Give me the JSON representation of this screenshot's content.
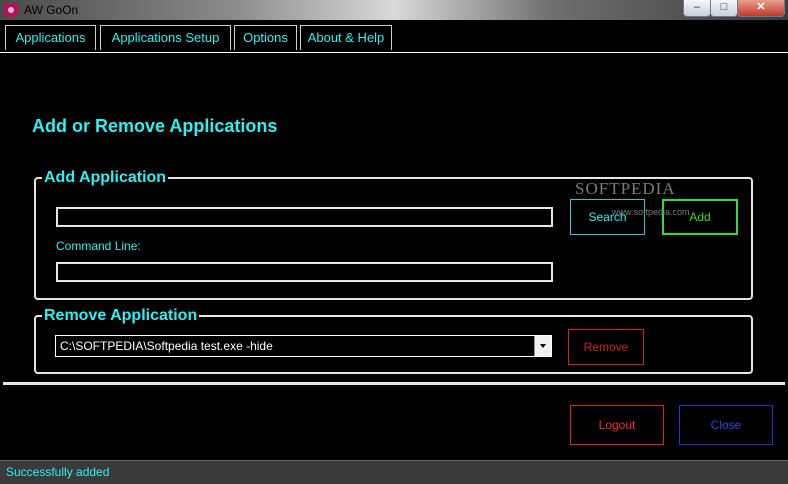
{
  "window": {
    "title": "AW GoOn",
    "controls": {
      "minimize": "–",
      "maximize": "□",
      "close": "✕"
    }
  },
  "tabs": [
    {
      "label": "Applications"
    },
    {
      "label": "Applications Setup"
    },
    {
      "label": "Options"
    },
    {
      "label": "About & Help"
    }
  ],
  "main": {
    "heading": "Add or Remove Applications",
    "add_group": {
      "title": "Add Application",
      "path_value": "",
      "command_line_label": "Command Line:",
      "command_line_value": "",
      "search_label": "Search",
      "add_label": "Add"
    },
    "remove_group": {
      "title": "Remove Application",
      "selected_app": "C:\\SOFTPEDIA\\Softpedia test.exe -hide",
      "remove_label": "Remove"
    }
  },
  "footer": {
    "logout_label": "Logout",
    "close_label": "Close"
  },
  "status": {
    "text": "Successfully added"
  },
  "watermark": {
    "text": "SOFTPEDIA",
    "url": "www.softpedia.com"
  },
  "colors": {
    "accent_cyan": "#2ef0f0",
    "add_green": "#33dd33",
    "red": "#dd2222",
    "blue": "#2233cc",
    "background": "#000000"
  },
  "icons": {
    "app": "app-icon",
    "combo_arrow": "chevron-down-icon"
  }
}
